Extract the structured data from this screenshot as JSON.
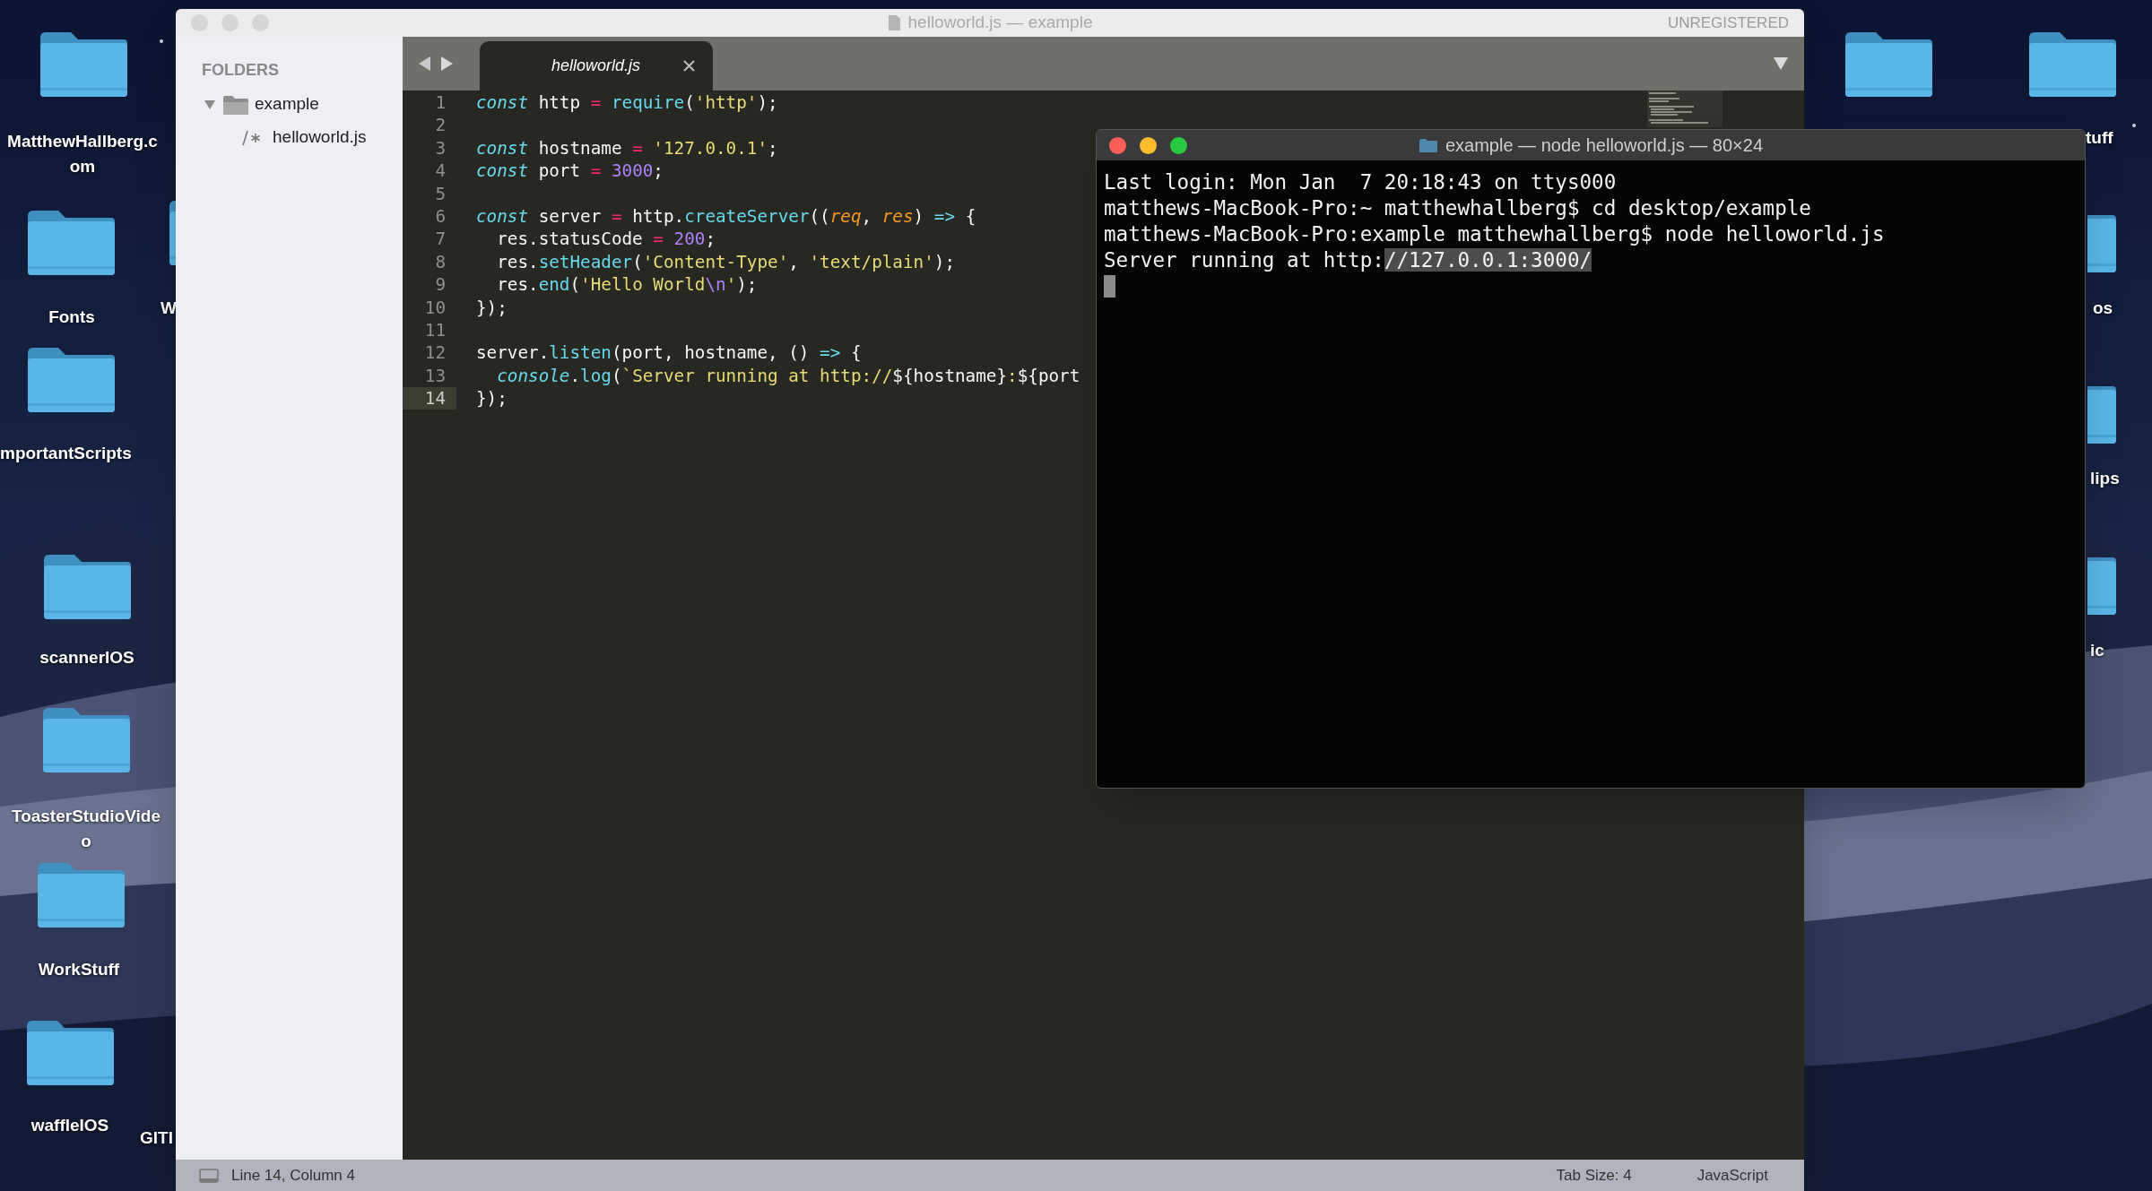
{
  "desktop": {
    "icons": [
      {
        "kind": "folder",
        "label": "MatthewHallberg.com"
      },
      {
        "kind": "folder",
        "label": "Fonts"
      },
      {
        "kind": "folder",
        "label": "W"
      },
      {
        "kind": "folder",
        "label": "mportantScripts"
      },
      {
        "kind": "folder",
        "label": "scannerIOS"
      },
      {
        "kind": "folder",
        "label": "ToasterStudioVideo"
      },
      {
        "kind": "folder",
        "label": "WorkStuff"
      },
      {
        "kind": "folder",
        "label": "waffleIOS"
      },
      {
        "kind": "text",
        "label": "GITI"
      },
      {
        "kind": "folder"
      },
      {
        "kind": "folder",
        "label": "tuff"
      },
      {
        "kind": "folder",
        "label": "os"
      },
      {
        "kind": "folder",
        "label": "lips"
      },
      {
        "kind": "folder",
        "label": "ic"
      }
    ]
  },
  "editor_window": {
    "title": "helloworld.js — example",
    "active": false,
    "license": "UNREGISTERED",
    "sidebar": {
      "heading": "FOLDERS",
      "tree": [
        {
          "label": "example",
          "expanded": true,
          "children": [
            {
              "label": "helloworld.js",
              "selected": false
            }
          ]
        }
      ]
    },
    "tabs": [
      {
        "label": "helloworld.js",
        "selected": true
      }
    ],
    "code": [
      {
        "number": "1",
        "current": false,
        "tokens": [
          {
            "kind": "kw",
            "text": "const"
          },
          {
            "kind": "plain",
            "text": " http "
          },
          {
            "kind": "op",
            "text": "= "
          },
          {
            "kind": "fn",
            "text": "require"
          },
          {
            "kind": "plain",
            "text": "("
          },
          {
            "kind": "str",
            "text": "'http'"
          },
          {
            "kind": "plain",
            "text": ");"
          }
        ]
      },
      {
        "number": "2",
        "current": false
      },
      {
        "number": "3",
        "current": false,
        "tokens": [
          {
            "kind": "kw",
            "text": "const"
          },
          {
            "kind": "plain",
            "text": " hostname "
          },
          {
            "kind": "op",
            "text": "= "
          },
          {
            "kind": "str",
            "text": "'127.0.0.1'"
          },
          {
            "kind": "plain",
            "text": ";"
          }
        ]
      },
      {
        "number": "4",
        "current": false,
        "tokens": [
          {
            "kind": "kw",
            "text": "const"
          },
          {
            "kind": "plain",
            "text": " port "
          },
          {
            "kind": "op",
            "text": "= "
          },
          {
            "kind": "num",
            "text": "3000"
          },
          {
            "kind": "plain",
            "text": ";"
          }
        ]
      },
      {
        "number": "5",
        "current": false
      },
      {
        "number": "6",
        "current": false,
        "tokens": [
          {
            "kind": "kw",
            "text": "const"
          },
          {
            "kind": "plain",
            "text": " server "
          },
          {
            "kind": "op",
            "text": "="
          },
          {
            "kind": "plain",
            "text": " http."
          },
          {
            "kind": "fn",
            "text": "createServer"
          },
          {
            "kind": "plain",
            "text": "(("
          },
          {
            "kind": "param",
            "text": "req"
          },
          {
            "kind": "plain",
            "text": ", "
          },
          {
            "kind": "param",
            "text": "res"
          },
          {
            "kind": "plain",
            "text": ") "
          },
          {
            "kind": "fn",
            "text": "=>"
          },
          {
            "kind": "plain",
            "text": " {"
          }
        ]
      },
      {
        "number": "7",
        "current": false,
        "tokens": [
          {
            "kind": "plain",
            "text": "  res.statusCode "
          },
          {
            "kind": "op",
            "text": "= "
          },
          {
            "kind": "num",
            "text": "200"
          },
          {
            "kind": "plain",
            "text": ";"
          }
        ]
      },
      {
        "number": "8",
        "current": false,
        "tokens": [
          {
            "kind": "plain",
            "text": "  res."
          },
          {
            "kind": "fn",
            "text": "setHeader"
          },
          {
            "kind": "plain",
            "text": "("
          },
          {
            "kind": "str",
            "text": "'Content-Type'"
          },
          {
            "kind": "plain",
            "text": ", "
          },
          {
            "kind": "str",
            "text": "'text/plain'"
          },
          {
            "kind": "plain",
            "text": ");"
          }
        ]
      },
      {
        "number": "9",
        "current": false,
        "tokens": [
          {
            "kind": "plain",
            "text": "  res."
          },
          {
            "kind": "fn",
            "text": "end"
          },
          {
            "kind": "plain",
            "text": "("
          },
          {
            "kind": "str",
            "text": "'Hello World"
          },
          {
            "kind": "num",
            "text": "\\n"
          },
          {
            "kind": "str",
            "text": "'"
          },
          {
            "kind": "plain",
            "text": ");"
          }
        ]
      },
      {
        "number": "10",
        "current": false,
        "tokens": [
          {
            "kind": "plain",
            "text": "});"
          }
        ]
      },
      {
        "number": "11",
        "current": false
      },
      {
        "number": "12",
        "current": false,
        "tokens": [
          {
            "kind": "plain",
            "text": "server."
          },
          {
            "kind": "fn",
            "text": "listen"
          },
          {
            "kind": "plain",
            "text": "(port, hostname, () "
          },
          {
            "kind": "fn",
            "text": "=>"
          },
          {
            "kind": "plain",
            "text": " {"
          }
        ]
      },
      {
        "number": "13",
        "current": false,
        "tokens": [
          {
            "kind": "kw",
            "text": "  console"
          },
          {
            "kind": "plain",
            "text": "."
          },
          {
            "kind": "fn",
            "text": "log"
          },
          {
            "kind": "plain",
            "text": "("
          },
          {
            "kind": "str",
            "text": "`Server running at http://"
          },
          {
            "kind": "plain",
            "text": "${hostname}"
          },
          {
            "kind": "str",
            "text": ":"
          },
          {
            "kind": "plain",
            "text": "${port"
          }
        ]
      },
      {
        "number": "14",
        "current": true,
        "tokens": [
          {
            "kind": "plain",
            "text": "});"
          }
        ]
      }
    ],
    "status_bar": {
      "position": "Line 14, Column 4",
      "tab_size": "Tab Size: 4",
      "syntax": "JavaScript"
    }
  },
  "terminal_window": {
    "title": "example — node helloworld.js — 80×24",
    "active": true,
    "cursor_visible": true,
    "lines": [
      {
        "segments": [
          {
            "text": "Last login: Mon Jan  7 20:18:43 on ttys000",
            "selected": false
          }
        ]
      },
      {
        "segments": [
          {
            "text": "matthews-MacBook-Pro:~ matthewhallberg$ cd desktop/example",
            "selected": false
          }
        ]
      },
      {
        "segments": [
          {
            "text": "matthews-MacBook-Pro:example matthewhallberg$ node helloworld.js",
            "selected": false
          }
        ]
      },
      {
        "segments": [
          {
            "text": "Server running at http:",
            "selected": false
          },
          {
            "text": "//127.0.0.1:3000/",
            "selected": true
          }
        ]
      }
    ]
  }
}
